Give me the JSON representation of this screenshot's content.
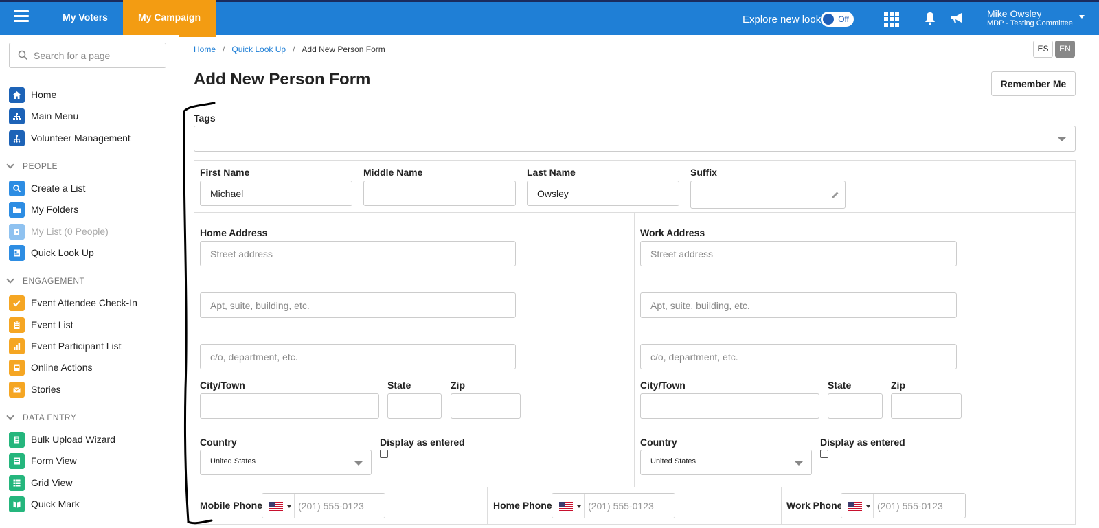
{
  "topbar": {
    "tab_voters": "My Voters",
    "tab_campaign": "My Campaign",
    "explore_label": "Explore new look",
    "toggle_label": "Off",
    "user_name": "Mike Owsley",
    "user_org": "MDP - Testing Committee",
    "accent_color": "#f39c12",
    "bar_color": "#1f7fd6"
  },
  "sidebar": {
    "search_placeholder": "Search for a page",
    "top_items": [
      {
        "label": "Home",
        "icon": "home-icon"
      },
      {
        "label": "Main Menu",
        "icon": "sitemap-icon"
      },
      {
        "label": "Volunteer Management",
        "icon": "volunteer-tree-icon"
      }
    ],
    "sections": [
      {
        "title": "PEOPLE",
        "items": [
          {
            "label": "Create a List",
            "icon": "search-icon"
          },
          {
            "label": "My Folders",
            "icon": "folder-icon"
          },
          {
            "label": "My List (0 People)",
            "icon": "list-icon",
            "disabled": true
          },
          {
            "label": "Quick Look Up",
            "icon": "id-card-icon"
          }
        ]
      },
      {
        "title": "ENGAGEMENT",
        "items": [
          {
            "label": "Event Attendee Check-In",
            "icon": "check-icon"
          },
          {
            "label": "Event List",
            "icon": "clipboard-icon"
          },
          {
            "label": "Event Participant List",
            "icon": "bar-chart-icon"
          },
          {
            "label": "Online Actions",
            "icon": "document-icon"
          },
          {
            "label": "Stories",
            "icon": "envelope-icon"
          }
        ]
      },
      {
        "title": "DATA ENTRY",
        "items": [
          {
            "label": "Bulk Upload Wizard",
            "icon": "stack-icon"
          },
          {
            "label": "Form View",
            "icon": "form-icon"
          },
          {
            "label": "Grid View",
            "icon": "grid-view-icon"
          },
          {
            "label": "Quick Mark",
            "icon": "book-icon"
          }
        ]
      }
    ]
  },
  "breadcrumb": {
    "home": "Home",
    "quick_lookup": "Quick Look Up",
    "current": "Add New Person Form"
  },
  "lang": {
    "es": "ES",
    "en": "EN"
  },
  "page": {
    "title": "Add New Person Form",
    "remember_button": "Remember Me"
  },
  "form": {
    "tags_label": "Tags",
    "first_name_label": "First Name",
    "first_name_value": "Michael",
    "middle_name_label": "Middle Name",
    "middle_name_value": "",
    "last_name_label": "Last Name",
    "last_name_value": "Owsley",
    "suffix_label": "Suffix",
    "home_address": {
      "label": "Home Address",
      "street_placeholder": "Street address",
      "apt_placeholder": "Apt, suite, building, etc.",
      "co_placeholder": "c/o, department, etc.",
      "city_label": "City/Town",
      "state_label": "State",
      "zip_label": "Zip",
      "country_label": "Country",
      "country_value": "United States",
      "display_label": "Display as entered"
    },
    "work_address": {
      "label": "Work Address",
      "street_placeholder": "Street address",
      "apt_placeholder": "Apt, suite, building, etc.",
      "co_placeholder": "c/o, department, etc.",
      "city_label": "City/Town",
      "state_label": "State",
      "zip_label": "Zip",
      "country_label": "Country",
      "country_value": "United States",
      "display_label": "Display as entered"
    },
    "phones": [
      {
        "label": "Mobile Phone",
        "placeholder": "(201) 555-0123"
      },
      {
        "label": "Home Phone",
        "placeholder": "(201) 555-0123"
      },
      {
        "label": "Work Phone",
        "placeholder": "(201) 555-0123"
      }
    ]
  }
}
